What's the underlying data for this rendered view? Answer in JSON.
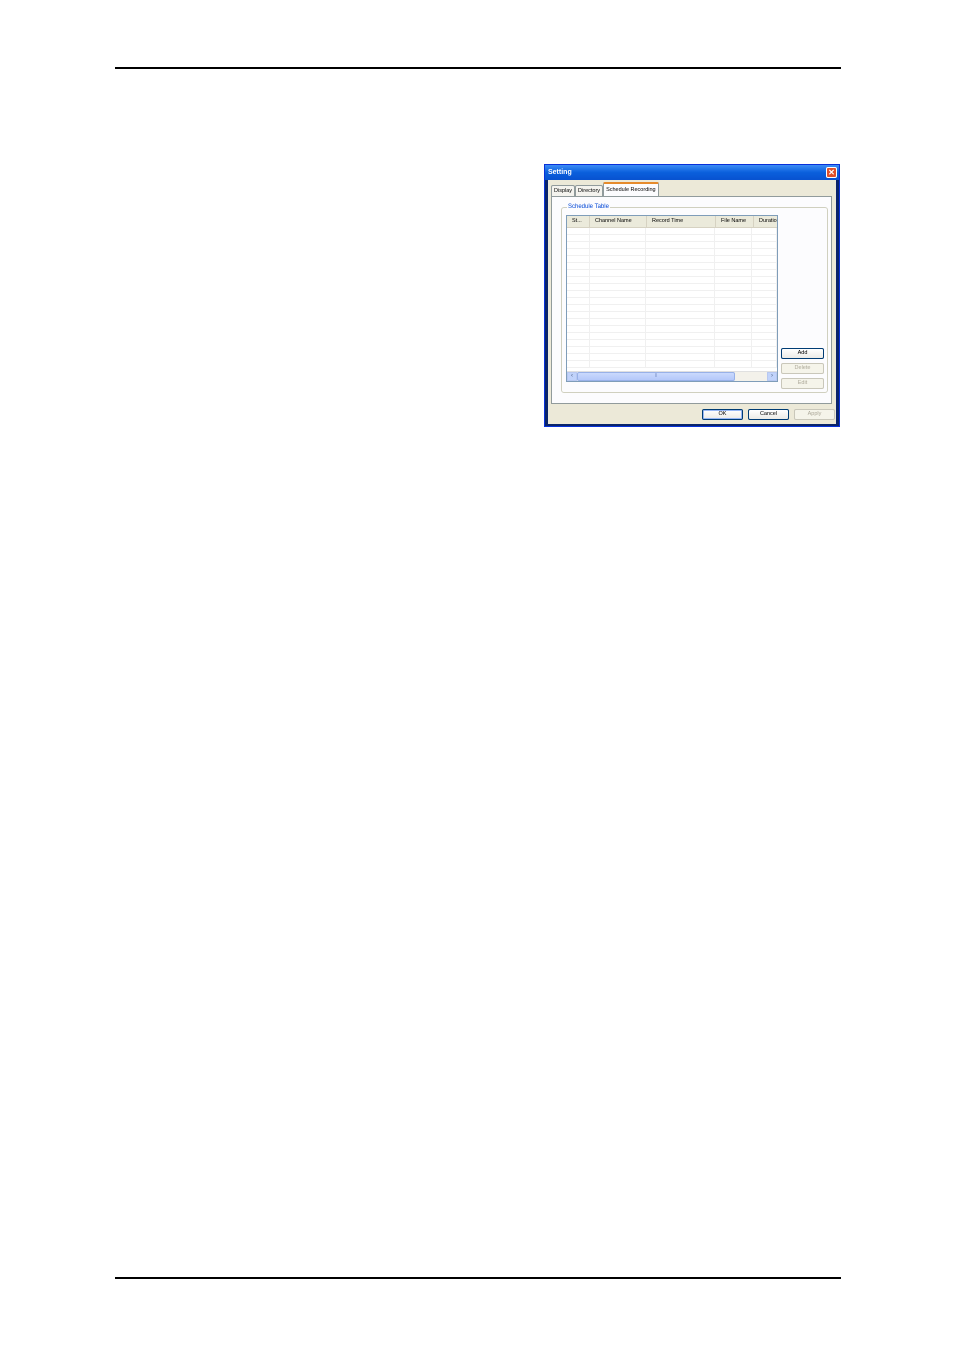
{
  "dialog": {
    "title": "Setting",
    "close_icon": "close-icon",
    "tabs": [
      {
        "label": "Display",
        "active": false
      },
      {
        "label": "Directory",
        "active": false
      },
      {
        "label": "Schedule Recording",
        "active": true
      }
    ],
    "group_label": "Schedule Table",
    "columns": [
      "St...",
      "Channel Name",
      "Record Time",
      "File Name",
      "Duratio"
    ],
    "scroll_thumb_glyph": "⦀",
    "side_buttons": {
      "add": "Add",
      "delete": "Delete",
      "edit": "Edit"
    },
    "footer_buttons": {
      "ok": "OK",
      "cancel": "Cancel",
      "apply": "Apply"
    }
  }
}
